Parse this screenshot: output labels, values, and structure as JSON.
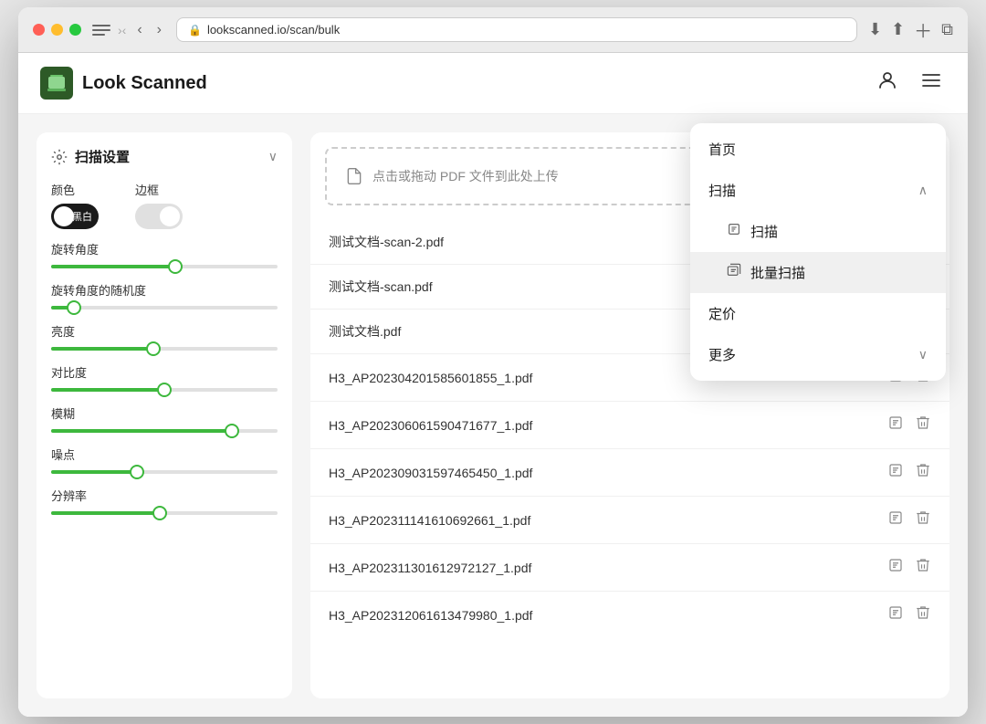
{
  "browser": {
    "url": "lookscanned.io/scan/bulk",
    "back_btn": "‹",
    "forward_btn": "›"
  },
  "app": {
    "title": "Look Scanned",
    "logo_icon": "🖥"
  },
  "settings": {
    "title": "扫描设置",
    "color_label": "颜色",
    "border_label": "边框",
    "toggle_label": "黑白",
    "rotation_label": "旋转角度",
    "rotation_random_label": "旋转角度的随机度",
    "brightness_label": "亮度",
    "contrast_label": "对比度",
    "blur_label": "模糊",
    "noise_label": "噪点",
    "resolution_label": "分辨率",
    "sliders": [
      {
        "id": "rotation",
        "fill_pct": 55
      },
      {
        "id": "rotation_random",
        "fill_pct": 10
      },
      {
        "id": "brightness",
        "fill_pct": 45
      },
      {
        "id": "contrast",
        "fill_pct": 50
      },
      {
        "id": "blur",
        "fill_pct": 80
      },
      {
        "id": "noise",
        "fill_pct": 38
      },
      {
        "id": "resolution",
        "fill_pct": 48
      }
    ]
  },
  "upload": {
    "prompt": "点击或拖动 PDF 文件到此处上传"
  },
  "files": [
    {
      "name": "测试文档-scan-2.pdf",
      "has_actions": false
    },
    {
      "name": "测试文档-scan.pdf",
      "has_actions": false
    },
    {
      "name": "测试文档.pdf",
      "has_actions": false
    },
    {
      "name": "H3_AP202304201585601855_1.pdf",
      "has_actions": true
    },
    {
      "name": "H3_AP202306061590471677_1.pdf",
      "has_actions": true
    },
    {
      "name": "H3_AP202309031597465450_1.pdf",
      "has_actions": true
    },
    {
      "name": "H3_AP202311141610692661_1.pdf",
      "has_actions": true
    },
    {
      "name": "H3_AP202311301612972127_1.pdf",
      "has_actions": true
    },
    {
      "name": "H3_AP202312061613479980_1.pdf",
      "has_actions": true
    }
  ],
  "menu": {
    "home": "首页",
    "scan": "扫描",
    "scan_sub": "扫描",
    "bulk_scan": "批量扫描",
    "pricing": "定价",
    "more": "更多"
  }
}
